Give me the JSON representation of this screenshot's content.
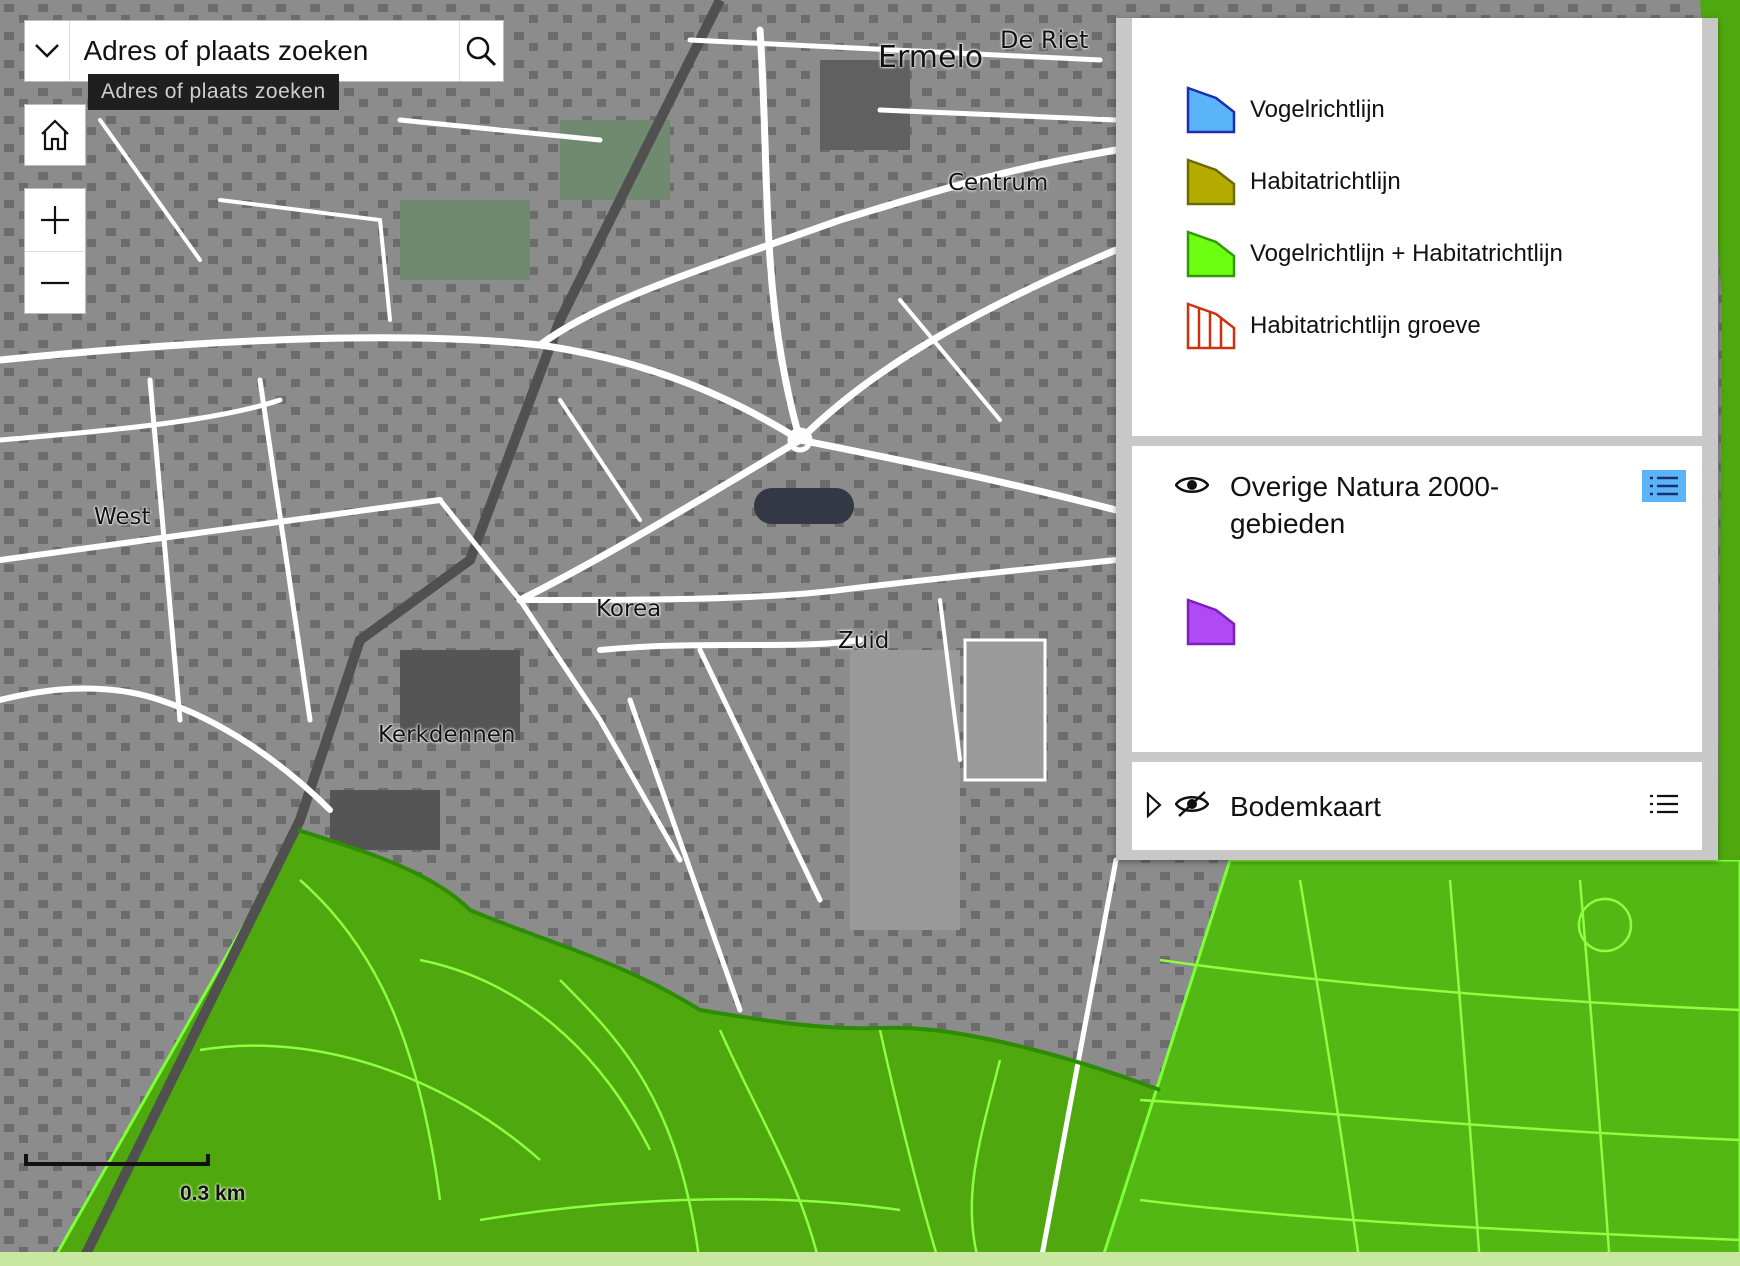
{
  "map": {
    "place_labels": [
      "Ermelo",
      "De Riet",
      "Centrum",
      "West",
      "Korea",
      "Zuid",
      "Kerkdennen"
    ],
    "natura_fill_color": "#52b80c",
    "urban_fill_color": "#8c8c8c",
    "road_color": "#ffffff"
  },
  "search": {
    "value": "Adres of plaats zoeken",
    "tooltip": "Adres of plaats zoeken"
  },
  "scalebar": {
    "label": "0.3 km"
  },
  "legend": {
    "natura_items": [
      {
        "label": "Vogelrichtlijn",
        "color": "#5ab4f7"
      },
      {
        "label": "Habitatrichtlijn",
        "color": "#b5ac00"
      },
      {
        "label": "Vogelrichtlijn + Habitatrichtlijn",
        "color": "#6dff12"
      },
      {
        "label": "Habitatrichtlijn groeve",
        "color": "#d03010"
      }
    ],
    "overige": {
      "title_line1": "Overige Natura 2000-",
      "title_line2": "gebieden",
      "swatch_color": "#b04af5"
    },
    "bodemkaart": {
      "title": "Bodemkaart"
    }
  }
}
